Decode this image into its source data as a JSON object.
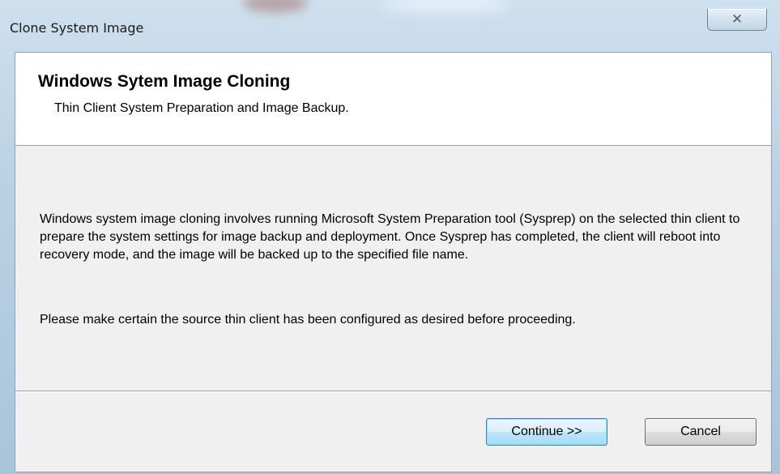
{
  "window": {
    "title": "Clone System Image",
    "close_icon": "close-icon"
  },
  "header": {
    "title": "Windows Sytem Image Cloning",
    "subtitle": "Thin Client System Preparation and Image Backup."
  },
  "content": {
    "paragraph1": "Windows system image cloning involves running Microsoft System Preparation tool (Sysprep) on the selected thin client to prepare the system settings for image backup and deployment. Once Sysprep has completed, the client will reboot into recovery mode, and the image will be backed up to the specified file name.",
    "paragraph2": "Please make certain the source thin client has been configured as desired before proceeding."
  },
  "buttons": {
    "continue_label": "Continue >>",
    "cancel_label": "Cancel"
  },
  "colors": {
    "header_bg": "#ffffff",
    "body_bg": "#f0f0f0",
    "default_button_border": "#3c7fb1"
  }
}
